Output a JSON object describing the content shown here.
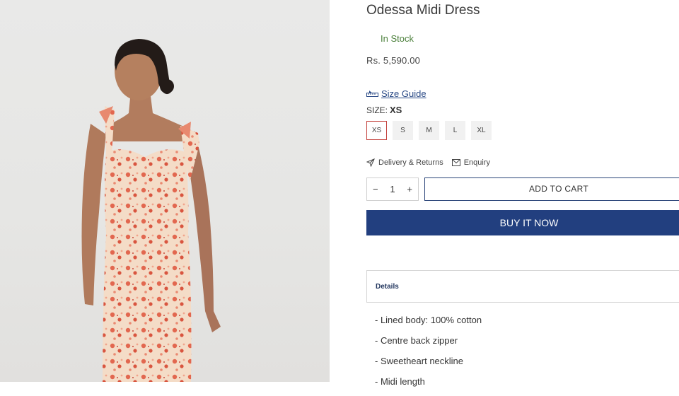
{
  "product": {
    "title": "Odessa Midi Dress",
    "stock": "In Stock",
    "price": "Rs. 5,590.00"
  },
  "size_guide": {
    "label": "Size Guide",
    "icon": "ruler-icon"
  },
  "size": {
    "label": "SIZE:",
    "selected": "XS",
    "options": [
      "XS",
      "S",
      "M",
      "L",
      "XL"
    ]
  },
  "links": {
    "delivery": "Delivery & Returns",
    "enquiry": "Enquiry"
  },
  "quantity": {
    "minus": "−",
    "value": "1",
    "plus": "+"
  },
  "buttons": {
    "add_to_cart": "ADD TO CART",
    "buy_now": "BUY IT NOW"
  },
  "details": {
    "heading": "Details",
    "items": [
      "- Lined body: 100% cotton",
      "- Centre back zipper",
      "- Sweetheart neckline",
      "- Midi length"
    ]
  },
  "colors": {
    "brand_navy": "#223f7f",
    "in_stock_green": "#4a7f3a",
    "selected_size_border": "#c4433e"
  }
}
